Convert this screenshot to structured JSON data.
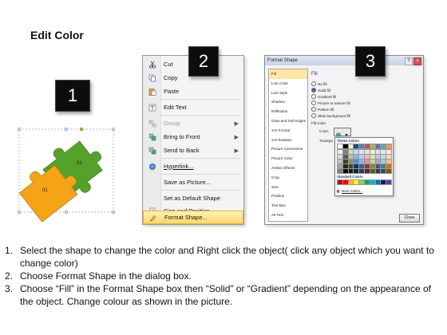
{
  "title": "Edit Color",
  "badges": [
    "1",
    "2",
    "3"
  ],
  "puzzle": {
    "piece_labels": [
      "01",
      "02"
    ],
    "colors": {
      "orange": "#f5a418",
      "green": "#55a22a"
    }
  },
  "context_menu": {
    "items": [
      {
        "label": "Cut",
        "icon": "scissors-icon",
        "disabled": false
      },
      {
        "label": "Copy",
        "icon": "copy-icon",
        "disabled": false
      },
      {
        "label": "Paste",
        "icon": "paste-icon",
        "disabled": false
      },
      {
        "label": "Edit Text",
        "icon": "edit-text-icon",
        "disabled": false
      },
      {
        "label": "Group",
        "icon": "group-icon",
        "disabled": true
      },
      {
        "label": "Bring to Front",
        "icon": "bring-front-icon",
        "disabled": false
      },
      {
        "label": "Send to Back",
        "icon": "send-back-icon",
        "disabled": false
      },
      {
        "label": "Hyperlink...",
        "icon": "hyperlink-icon",
        "disabled": false
      },
      {
        "label": "Save as Picture...",
        "icon": "",
        "disabled": false
      },
      {
        "label": "Set as Default Shape",
        "icon": "",
        "disabled": false
      },
      {
        "label": "Size and Position...",
        "icon": "size-position-icon",
        "disabled": false
      },
      {
        "label": "Format Shape...",
        "icon": "format-shape-icon",
        "disabled": false
      }
    ]
  },
  "dialog": {
    "title": "Format Shape",
    "categories": [
      "Fill",
      "Line Color",
      "Line Style",
      "Shadow",
      "Reflection",
      "Glow and Soft Edges",
      "3-D Format",
      "3-D Rotation",
      "Picture Corrections",
      "Picture Color",
      "Artistic Effects",
      "Crop",
      "Size",
      "Position",
      "Text Box",
      "Alt Text"
    ],
    "fill_heading": "Fill",
    "options": [
      "No fill",
      "Solid fill",
      "Gradient fill",
      "Picture or texture fill",
      "Pattern fill",
      "Slide background fill"
    ],
    "fill_color_label": "Fill Color",
    "color_label": "Color:",
    "transparency_label": "Transpa",
    "theme_colors_label": "Theme Colors",
    "standard_colors_label": "Standard Colors",
    "more_colors_label": "More Colors...",
    "close_label": "Close"
  },
  "palette": {
    "theme_top": [
      "#ffffff",
      "#000000",
      "#eeece1",
      "#1f497d",
      "#4f81bd",
      "#c0504d",
      "#9bbb59",
      "#8064a2",
      "#4bacc6",
      "#f79646"
    ],
    "theme_shades": [
      [
        "#f2f2f2",
        "#7f7f7f",
        "#ddd9c3",
        "#c6d9f0",
        "#dbe5f1",
        "#f2dcdb",
        "#ebf1dd",
        "#e5e0ec",
        "#dbeef3",
        "#fdeada"
      ],
      [
        "#d8d8d8",
        "#595959",
        "#c4bd97",
        "#8db3e2",
        "#b8cce4",
        "#e5b9b7",
        "#d7e3bc",
        "#ccc1d9",
        "#b7dde8",
        "#fbd5b5"
      ],
      [
        "#bfbfbf",
        "#3f3f3f",
        "#938953",
        "#548dd4",
        "#95b3d7",
        "#d99694",
        "#c3d69b",
        "#b2a2c7",
        "#92cddc",
        "#fac08f"
      ],
      [
        "#a5a5a5",
        "#262626",
        "#494429",
        "#17365d",
        "#366092",
        "#953734",
        "#76923c",
        "#5f497a",
        "#31859b",
        "#e36c09"
      ],
      [
        "#7f7f7f",
        "#0c0c0c",
        "#1d1b10",
        "#0f243e",
        "#244061",
        "#632423",
        "#4f6128",
        "#3f3151",
        "#205867",
        "#974806"
      ]
    ],
    "standard": [
      "#c00000",
      "#ff0000",
      "#ffc000",
      "#ffff00",
      "#92d050",
      "#00b050",
      "#00b0f0",
      "#0070c0",
      "#002060",
      "#7030a0"
    ]
  },
  "steps": [
    {
      "num": "1.",
      "text": "Select the shape to change the color and Right click the object( click any object which you want to change color)"
    },
    {
      "num": "2.",
      "text": "Choose Format Shape in the dialog box."
    },
    {
      "num": "3.",
      "text": "Choose “Fill” in the Format Shape box then “Solid” or “Gradient” depending on the appearance of the object. Change colour as shown in the picture."
    }
  ]
}
